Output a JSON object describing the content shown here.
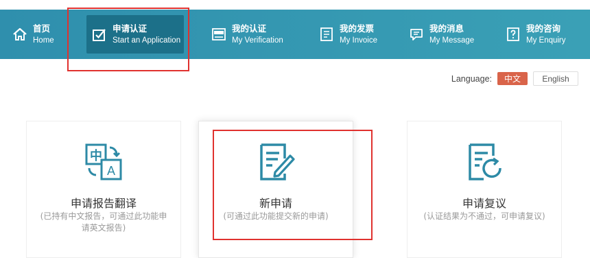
{
  "nav": {
    "items": [
      {
        "zh": "首页",
        "en": "Home",
        "icon": "home-icon"
      },
      {
        "zh": "申请认证",
        "en": "Start an Application",
        "icon": "apply-check-icon",
        "active": true
      },
      {
        "zh": "我的认证",
        "en": "My Verification",
        "icon": "verification-icon"
      },
      {
        "zh": "我的发票",
        "en": "My Invoice",
        "icon": "invoice-icon"
      },
      {
        "zh": "我的消息",
        "en": "My Message",
        "icon": "message-icon"
      },
      {
        "zh": "我的咨询",
        "en": "My Enquiry",
        "icon": "enquiry-icon"
      }
    ]
  },
  "language": {
    "label": "Language:",
    "zh": "中文",
    "en": "English",
    "selected": "中文"
  },
  "cards": [
    {
      "title": "申请报告翻译",
      "desc": "(已持有中文报告，可通过此功能申请英文报告)",
      "icon": "translate-icon"
    },
    {
      "title": "新申请",
      "desc": "(可通过此功能提交新的申请)",
      "icon": "new-application-icon"
    },
    {
      "title": "申请复议",
      "desc": "(认证结果为不通过，可申请复议)",
      "icon": "reconsideration-icon"
    }
  ],
  "colors": {
    "nav_bg": "#3399b3",
    "nav_active": "#1c7089",
    "accent": "#2d8aa6",
    "lang_active": "#d9644a",
    "highlight": "#e0312e"
  }
}
